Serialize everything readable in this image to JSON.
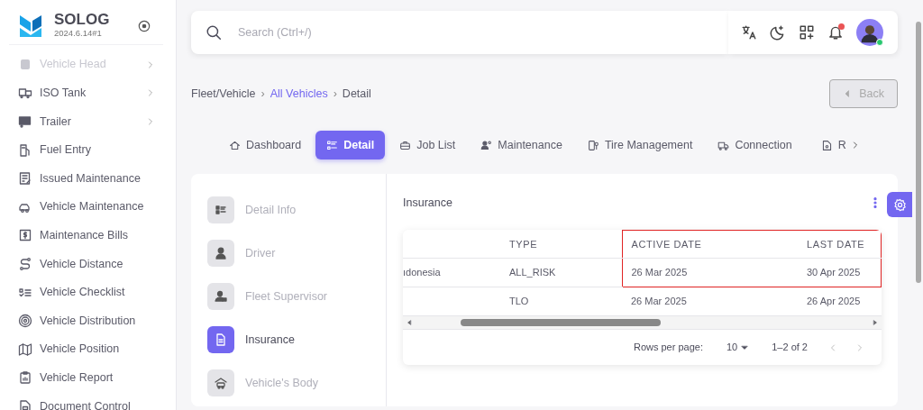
{
  "brand": {
    "name": "SOLOG",
    "version": "2024.6.14#1"
  },
  "sidebar": {
    "items": [
      {
        "label": "Vehicle Head",
        "expandable": true,
        "faded": true
      },
      {
        "label": "ISO Tank",
        "expandable": true,
        "faded": false
      },
      {
        "label": "Trailer",
        "expandable": true,
        "faded": false
      },
      {
        "label": "Fuel Entry",
        "expandable": false,
        "faded": false
      },
      {
        "label": "Issued Maintenance",
        "expandable": false,
        "faded": false
      },
      {
        "label": "Vehicle Maintenance",
        "expandable": false,
        "faded": false
      },
      {
        "label": "Maintenance Bills",
        "expandable": false,
        "faded": false
      },
      {
        "label": "Vehicle Distance",
        "expandable": false,
        "faded": false
      },
      {
        "label": "Vehicle Checklist",
        "expandable": false,
        "faded": false
      },
      {
        "label": "Vehicle Distribution",
        "expandable": false,
        "faded": false
      },
      {
        "label": "Vehicle Position",
        "expandable": false,
        "faded": false
      },
      {
        "label": "Vehicle Report",
        "expandable": false,
        "faded": false
      },
      {
        "label": "Document Control",
        "expandable": false,
        "faded": false
      }
    ]
  },
  "search": {
    "placeholder": "Search (Ctrl+/)"
  },
  "notifications": {
    "unread": true
  },
  "breadcrumb_separator": "›",
  "breadcrumb": [
    {
      "label": "Fleet/Vehicle",
      "link": false
    },
    {
      "label": "All Vehicles",
      "link": true
    },
    {
      "label": "Detail",
      "link": false
    }
  ],
  "back_button": {
    "label": "Back",
    "disabled": true
  },
  "tabs": [
    {
      "label": "Dashboard",
      "selected": false
    },
    {
      "label": "Detail",
      "selected": true
    },
    {
      "label": "Job List",
      "selected": false
    },
    {
      "label": "Maintenance",
      "selected": false
    },
    {
      "label": "Tire Management",
      "selected": false
    },
    {
      "label": "Connection",
      "selected": false
    },
    {
      "label": "R",
      "selected": false
    }
  ],
  "side_tabs": [
    {
      "label": "Detail Info",
      "selected": false
    },
    {
      "label": "Driver",
      "selected": false
    },
    {
      "label": "Fleet Supervisor",
      "selected": false
    },
    {
      "label": "Insurance",
      "selected": true
    },
    {
      "label": "Vehicle's Body",
      "selected": false
    }
  ],
  "panel": {
    "title": "Insurance"
  },
  "table": {
    "columns": [
      {
        "highlighted": false
      },
      {
        "label": "TYPE",
        "highlighted": false
      },
      {
        "label": "ACTIVE DATE",
        "highlighted": true
      },
      {
        "label": "LAST DATE",
        "highlighted": true
      }
    ],
    "rows": [
      {
        "cells": [
          "ıdonesia",
          "ALL_RISK",
          "26 Mar 2025",
          "30 Apr 2025"
        ],
        "highlighted": true
      },
      {
        "cells": [
          "",
          "TLO",
          "26 Mar 2025",
          "26 Apr 2025"
        ],
        "highlighted": false
      }
    ]
  },
  "pagination": {
    "rows_label": "Rows per page:",
    "rows_value": "10",
    "range": "1–2 of 2"
  }
}
